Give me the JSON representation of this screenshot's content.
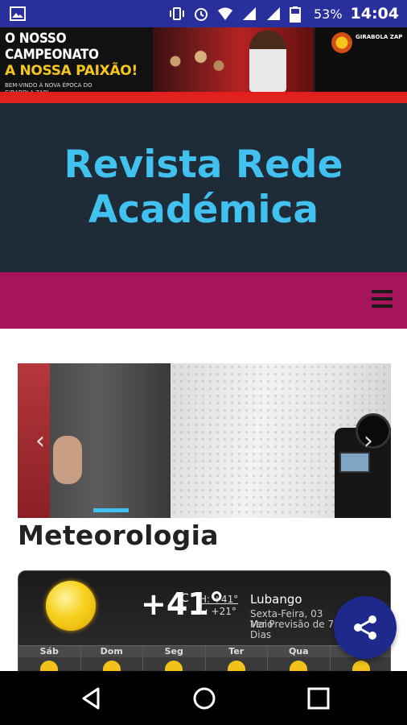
{
  "status_bar": {
    "battery_percent": "53%",
    "time": "14:04"
  },
  "ad": {
    "line1": "O NOSSO CAMPEONATO",
    "line2": "A NOSSA PAIXÃO!",
    "line3": "BEM-VINDO À NOVA ÉPOCA DO GIRABOLA ZAP!",
    "logo_text": "GIRABOLA ZAP"
  },
  "site": {
    "title": "Revista Rede Académica"
  },
  "slider": {
    "prev_label": "‹",
    "next_label": "›"
  },
  "section": {
    "title": "Meteorologia"
  },
  "weather": {
    "temperature": "+41°",
    "unit": "C",
    "high": "H: +41°",
    "low": "L: +21°",
    "city": "Lubango",
    "date": "Sexta-Feira, 03 Maio",
    "forecast_link": "Ver Previsão de 7 Dias",
    "days": [
      "Sáb",
      "Dom",
      "Seg",
      "Ter",
      "Qua",
      ""
    ]
  },
  "icons": {
    "share": "share-icon",
    "menu": "hamburger-menu-icon",
    "colors": {
      "header_bg": "#1f2b37",
      "title_blue": "#40c1ef",
      "nav_magenta": "#a8145c",
      "fab_blue": "#1d2a8c"
    }
  }
}
